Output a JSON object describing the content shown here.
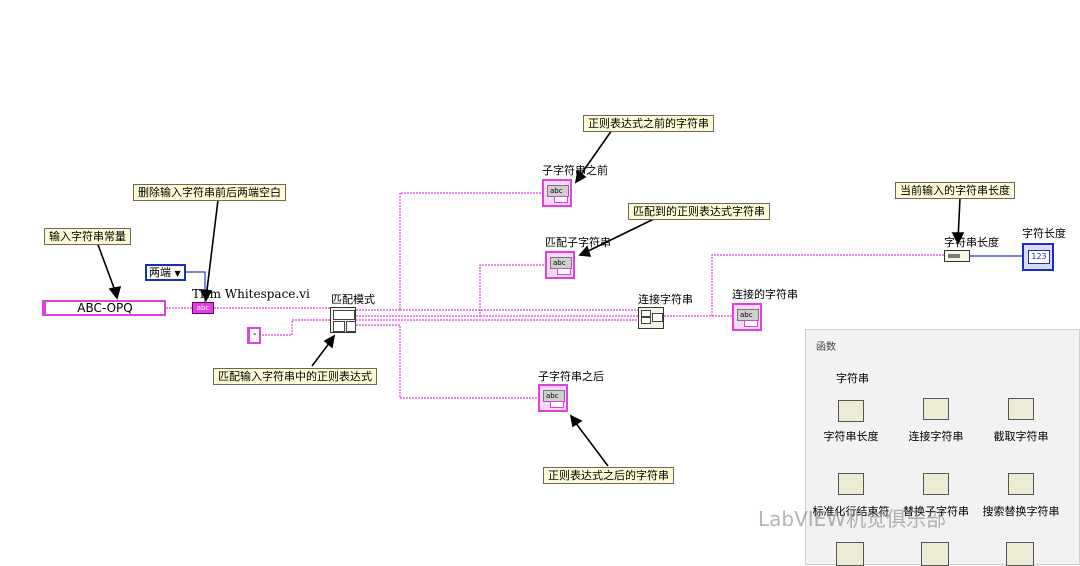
{
  "diagram": {
    "notes": {
      "input_const": "输入字符串常量",
      "trim": "删除输入字符串前后两端空白",
      "regex_before": "正则表达式之前的字符串",
      "regex_match": "匹配到的正则表达式字符串",
      "regex_input": "匹配输入字符串中的正则表达式",
      "regex_after": "正则表达式之后的字符串",
      "length_current": "当前输入的字符串长度"
    },
    "labels": {
      "string_const_value": "ABC-OPQ",
      "both_ends": "两端",
      "trim_vi": "Trim Whitespace.vi",
      "match_pattern": "匹配模式",
      "sub_before": "子字符串之前",
      "match_sub": "匹配子字符串",
      "sub_after": "子字符串之后",
      "concat_node": "连接字符串",
      "concat_result": "连接的字符串",
      "strlen_node": "字符串长度",
      "str_length": "字符长度",
      "regex_const": "-",
      "abc": "abc",
      "num": "123"
    }
  },
  "palette": {
    "title": "函数",
    "category": "字符串",
    "items": [
      {
        "label": "字符串长度"
      },
      {
        "label": "连接字符串"
      },
      {
        "label": "截取字符串"
      },
      {
        "label": "标准化行结束符"
      },
      {
        "label": "替换子字符串"
      },
      {
        "label": "搜索替换字符串"
      }
    ]
  },
  "watermark": "LabVIEW机觉俱乐部",
  "colors": {
    "string_wire": "#e040e0",
    "number_wire": "#2a3bd0",
    "note_bg": "#fdfbd6"
  }
}
